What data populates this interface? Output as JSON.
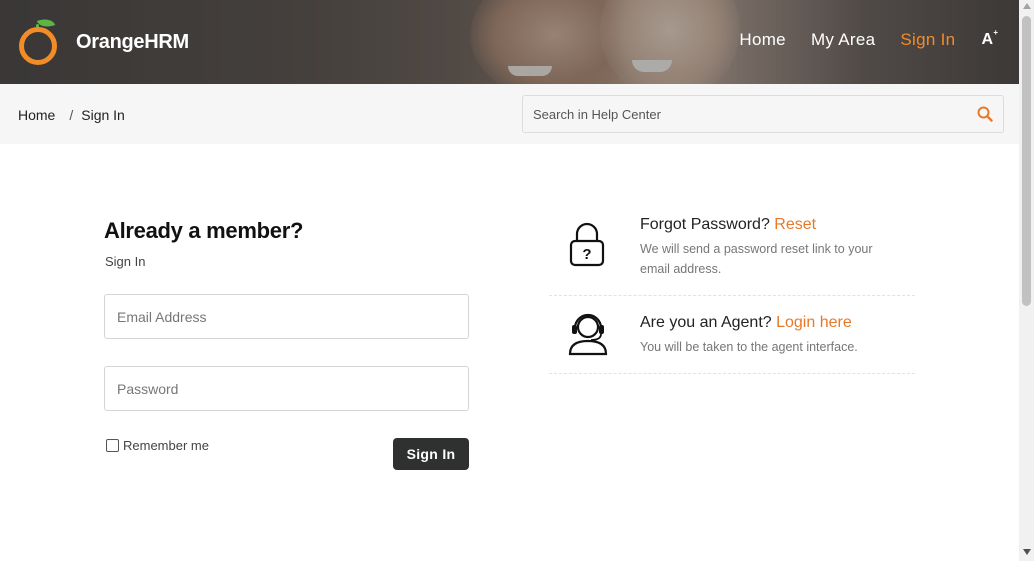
{
  "header": {
    "brand": "OrangeHRM",
    "nav": [
      {
        "label": "Home",
        "active": false
      },
      {
        "label": "My Area",
        "active": false
      },
      {
        "label": "Sign In",
        "active": true
      }
    ],
    "font_size_icon": "A",
    "font_size_sup": "+"
  },
  "breadcrumb": {
    "home": "Home",
    "separator": "/",
    "current": "Sign In"
  },
  "search": {
    "placeholder": "Search in Help Center",
    "icon": "search-icon"
  },
  "login": {
    "title": "Already a member?",
    "subtitle": "Sign In",
    "email_placeholder": "Email Address",
    "password_placeholder": "Password",
    "remember_label": "Remember me",
    "remember_checked": false,
    "submit_label": "Sign In"
  },
  "help": {
    "forgot": {
      "title": "Forgot Password?",
      "link": "Reset",
      "description": "We will send a password reset link to your email address.",
      "icon": "padlock-question-icon"
    },
    "agent": {
      "title": "Are you an Agent?",
      "link": "Login here",
      "description": "You will be taken to the agent interface.",
      "icon": "headset-agent-icon"
    }
  },
  "colors": {
    "accent": "#f28c28",
    "link": "#e8782a",
    "button": "#2f3030",
    "leaf": "#5db545"
  }
}
